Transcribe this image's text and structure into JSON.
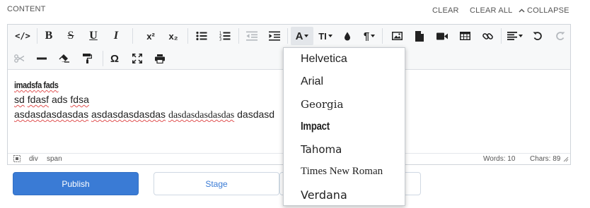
{
  "header": {
    "section_label": "CONTENT",
    "clear_label": "CLEAR",
    "clear_all_label": "CLEAR ALL",
    "collapse_label": "COLLAPSE"
  },
  "toolbar": {
    "row1": [
      {
        "name": "code-view",
        "icon": "code-icon"
      },
      {
        "name": "bold",
        "icon": "bold-icon",
        "label": "B"
      },
      {
        "name": "strikethrough",
        "icon": "strikethrough-icon",
        "label": "S"
      },
      {
        "name": "underline",
        "icon": "underline-icon",
        "label": "U"
      },
      {
        "name": "italic",
        "icon": "italic-icon",
        "label": "I"
      },
      {
        "name": "superscript",
        "icon": "superscript-icon",
        "label": "x²"
      },
      {
        "name": "subscript",
        "icon": "subscript-icon",
        "label": "x₂"
      },
      {
        "name": "unordered-list",
        "icon": "bullet-list-icon"
      },
      {
        "name": "ordered-list",
        "icon": "numbered-list-icon"
      },
      {
        "name": "outdent",
        "icon": "outdent-icon",
        "disabled": true
      },
      {
        "name": "indent",
        "icon": "indent-icon"
      },
      {
        "name": "font-family",
        "icon": "font-family-icon",
        "label": "A",
        "active": true
      },
      {
        "name": "font-size",
        "icon": "font-size-icon",
        "label": "TI"
      },
      {
        "name": "text-color",
        "icon": "droplet-icon"
      },
      {
        "name": "paragraph-format",
        "icon": "pilcrow-icon",
        "label": "¶"
      },
      {
        "name": "insert-image",
        "icon": "image-icon"
      },
      {
        "name": "insert-file",
        "icon": "file-icon"
      },
      {
        "name": "insert-video",
        "icon": "video-icon"
      },
      {
        "name": "insert-table",
        "icon": "table-icon"
      },
      {
        "name": "insert-link",
        "icon": "link-icon"
      },
      {
        "name": "align",
        "icon": "align-icon"
      },
      {
        "name": "undo",
        "icon": "undo-icon"
      },
      {
        "name": "redo",
        "icon": "redo-icon",
        "disabled": true
      }
    ],
    "row2": [
      {
        "name": "cut",
        "icon": "scissors-icon",
        "disabled": true
      },
      {
        "name": "horizontal-line",
        "icon": "horizontal-line-icon"
      },
      {
        "name": "clear-formatting",
        "icon": "eraser-icon"
      },
      {
        "name": "paint-format",
        "icon": "paint-roller-icon"
      },
      {
        "name": "special-characters",
        "icon": "omega-icon",
        "label": "Ω"
      },
      {
        "name": "fullscreen",
        "icon": "expand-icon"
      },
      {
        "name": "print",
        "icon": "print-icon"
      }
    ]
  },
  "editor": {
    "line1": "imadsfa fads",
    "line2a": "sd",
    "line2b": "fdasf",
    "line2c": "ads",
    "line2d": "fdsa",
    "line3a": "asdasdasdasdas",
    "line3b": "asdasdasdasdas",
    "line3c": "dasdasdasdasdas",
    "line3d": "dasdasd"
  },
  "statusbar": {
    "path_div": "div",
    "path_span": "span",
    "words": "Words: 10",
    "chars": "Chars: 89"
  },
  "font_dropdown": {
    "options": [
      "Helvetica",
      "Arial",
      "Georgia",
      "Impact",
      "Tahoma",
      "Times New Roman",
      "Verdana"
    ]
  },
  "buttons": {
    "publish": "Publish",
    "stage": "Stage"
  },
  "colors": {
    "primary": "#3a7bd5",
    "toolbar_bg": "#f7f8f9",
    "border": "#cfd4da",
    "spellcheck": "#e05050"
  }
}
